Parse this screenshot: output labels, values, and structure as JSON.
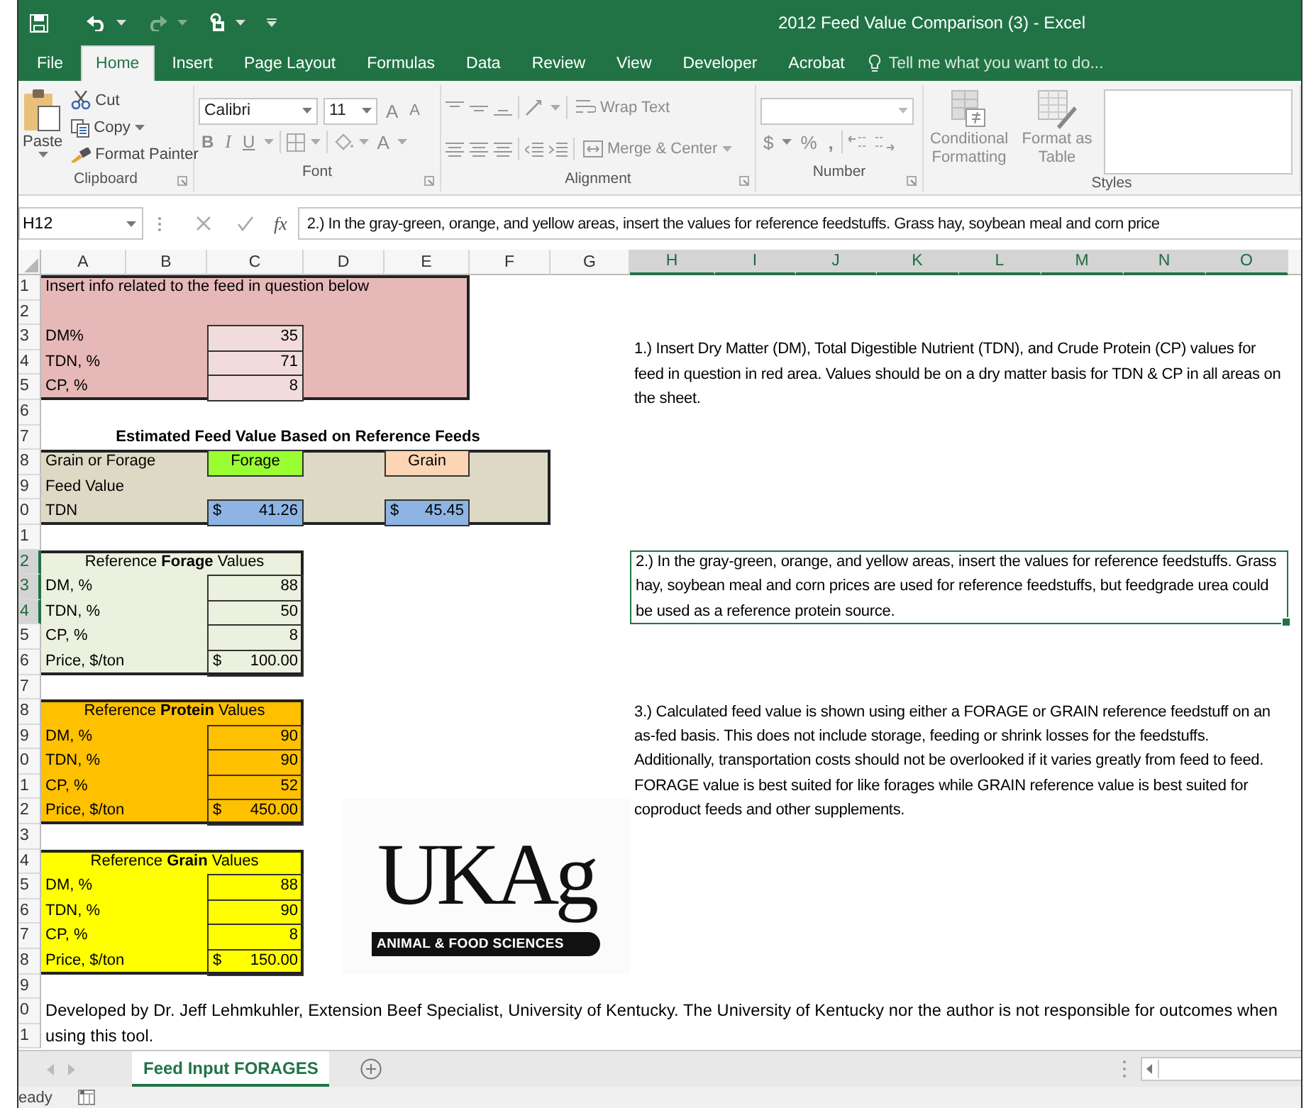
{
  "title_bar": {
    "title": "2012 Feed Value Comparison (3) - Excel"
  },
  "ribbon_tabs": [
    {
      "label": "File",
      "selected": false
    },
    {
      "label": "Home",
      "selected": true
    },
    {
      "label": "Insert",
      "selected": false
    },
    {
      "label": "Page Layout",
      "selected": false
    },
    {
      "label": "Formulas",
      "selected": false
    },
    {
      "label": "Data",
      "selected": false
    },
    {
      "label": "Review",
      "selected": false
    },
    {
      "label": "View",
      "selected": false
    },
    {
      "label": "Developer",
      "selected": false
    },
    {
      "label": "Acrobat",
      "selected": false
    }
  ],
  "tell_me": {
    "placeholder": "Tell me what you want to do..."
  },
  "ribbon": {
    "clipboard": {
      "label": "Clipboard",
      "paste": "Paste",
      "cut": "Cut",
      "copy": "Copy",
      "format_painter": "Format Painter"
    },
    "font": {
      "label": "Font",
      "font_name": "Calibri",
      "font_size": "11",
      "grow": "A",
      "shrink": "A",
      "bold": "B",
      "italic": "I",
      "underline": "U",
      "font_color": "A"
    },
    "alignment": {
      "label": "Alignment",
      "wrap_text": "Wrap Text",
      "merge_center": "Merge & Center"
    },
    "number": {
      "label": "Number",
      "currency": "$",
      "percent": "%",
      "comma": ","
    },
    "styles": {
      "label": "Styles",
      "conditional_formatting": "Conditional Formatting",
      "format_as_table": "Format as Table"
    }
  },
  "formula_bar": {
    "name_box": "H12",
    "fx": "fx",
    "formula": "2.) In the gray-green, orange, and yellow areas, insert the values for reference feedstuffs. Grass hay, soybean meal and corn price"
  },
  "sheet": {
    "column_headers": [
      {
        "label": "A",
        "selected": false
      },
      {
        "label": "B",
        "selected": false
      },
      {
        "label": "C",
        "selected": false
      },
      {
        "label": "D",
        "selected": false
      },
      {
        "label": "E",
        "selected": false
      },
      {
        "label": "F",
        "selected": false
      },
      {
        "label": "G",
        "selected": false
      },
      {
        "label": "H",
        "selected": true
      },
      {
        "label": "I",
        "selected": true
      },
      {
        "label": "J",
        "selected": true
      },
      {
        "label": "K",
        "selected": true
      },
      {
        "label": "L",
        "selected": true
      },
      {
        "label": "M",
        "selected": true
      },
      {
        "label": "N",
        "selected": true
      },
      {
        "label": "O",
        "selected": true
      }
    ],
    "row_headers": [
      {
        "label": "1",
        "selected": false
      },
      {
        "label": "2",
        "selected": false
      },
      {
        "label": "3",
        "selected": false
      },
      {
        "label": "4",
        "selected": false
      },
      {
        "label": "5",
        "selected": false
      },
      {
        "label": "6",
        "selected": false
      },
      {
        "label": "7",
        "selected": false
      },
      {
        "label": "8",
        "selected": false
      },
      {
        "label": "9",
        "selected": false
      },
      {
        "label": "0",
        "selected": false
      },
      {
        "label": "1",
        "selected": false
      },
      {
        "label": "2",
        "selected": true
      },
      {
        "label": "3",
        "selected": true
      },
      {
        "label": "4",
        "selected": true
      },
      {
        "label": "5",
        "selected": false
      },
      {
        "label": "6",
        "selected": false
      },
      {
        "label": "7",
        "selected": false
      },
      {
        "label": "8",
        "selected": false
      },
      {
        "label": "9",
        "selected": false
      },
      {
        "label": "0",
        "selected": false
      },
      {
        "label": "1",
        "selected": false
      },
      {
        "label": "2",
        "selected": false
      },
      {
        "label": "3",
        "selected": false
      },
      {
        "label": "4",
        "selected": false
      },
      {
        "label": "5",
        "selected": false
      },
      {
        "label": "6",
        "selected": false
      },
      {
        "label": "7",
        "selected": false
      },
      {
        "label": "8",
        "selected": false
      },
      {
        "label": "9",
        "selected": false
      },
      {
        "label": "0",
        "selected": false
      },
      {
        "label": "1",
        "selected": false
      }
    ],
    "input_section": {
      "heading": "Insert info related to the feed in question below",
      "rows": [
        {
          "label": "DM%",
          "value": "35"
        },
        {
          "label": "TDN, %",
          "value": "71"
        },
        {
          "label": "CP, %",
          "value": "8"
        }
      ]
    },
    "estimate_section": {
      "title": "Estimated Feed Value Based on Reference Feeds",
      "rows": [
        {
          "label": "Grain or Forage",
          "options": [
            {
              "text": "Forage",
              "kind": "forage"
            },
            {
              "text": "Grain",
              "kind": "grain"
            }
          ]
        },
        {
          "label": "Feed Value"
        },
        {
          "label": "TDN",
          "values": [
            {
              "currency": "$",
              "amount": "41.26"
            },
            {
              "currency": "$",
              "amount": "45.45"
            }
          ]
        }
      ]
    },
    "reference_sections": [
      {
        "title": "Reference **Forage** Values",
        "color": "#ebf1de",
        "rows": [
          {
            "label": "DM, %",
            "value": "88"
          },
          {
            "label": "TDN, %",
            "value": "50"
          },
          {
            "label": "CP, %",
            "value": "8"
          },
          {
            "label": "Price, $/ton",
            "currency": "$",
            "value": "100.00"
          }
        ]
      },
      {
        "title": "Reference **Protein** Values",
        "color": "#ffc000",
        "rows": [
          {
            "label": "DM, %",
            "value": "90"
          },
          {
            "label": "TDN, %",
            "value": "90"
          },
          {
            "label": "CP, %",
            "value": "52"
          },
          {
            "label": "Price, $/ton",
            "currency": "$",
            "value": "450.00"
          }
        ]
      },
      {
        "title": "Reference **Grain** Values",
        "color": "#ffff00",
        "rows": [
          {
            "label": "DM, %",
            "value": "88"
          },
          {
            "label": "TDN, %",
            "value": "90"
          },
          {
            "label": "CP, %",
            "value": "8"
          },
          {
            "label": "Price, $/ton",
            "currency": "$",
            "value": "150.00"
          }
        ]
      }
    ],
    "notes": [
      {
        "text": "1.) Insert Dry Matter (DM), Total Digestible Nutrient (TDN), and Crude Protein (CP) values for feed in question in red area.  Values should be on a dry matter basis for TDN & CP in all areas on the sheet.",
        "selected": false
      },
      {
        "text": "2.) In the gray-green, orange, and yellow areas, insert the values for reference feedstuffs. Grass hay, soybean meal and corn prices are used for reference feedstuffs, but feedgrade urea could be used as a reference protein source.",
        "selected": true
      },
      {
        "text": "3.) Calculated feed value is shown using either a FORAGE or GRAIN reference feedstuff on an as-fed basis.  This does not include storage, feeding or shrink losses for the feedstuffs.  Additionally, transportation costs should not be overlooked if it varies greatly from feed to feed.  FORAGE value is best suited for like forages while GRAIN reference value is best suited for coproduct feeds and other supplements.",
        "selected": false
      }
    ],
    "logo": {
      "wordmark": "UKAg",
      "tagline": "ANIMAL & FOOD SCIENCES"
    },
    "footer_note": "Developed by Dr. Jeff Lehmkuhler, Extension Beef Specialist, University of Kentucky.  The University of Kentucky nor the author is not responsible for outcomes when using this tool."
  },
  "sheet_tabs": [
    {
      "label": "Feed Input FORAGES",
      "selected": true
    }
  ],
  "status_bar": {
    "text": "eady"
  }
}
